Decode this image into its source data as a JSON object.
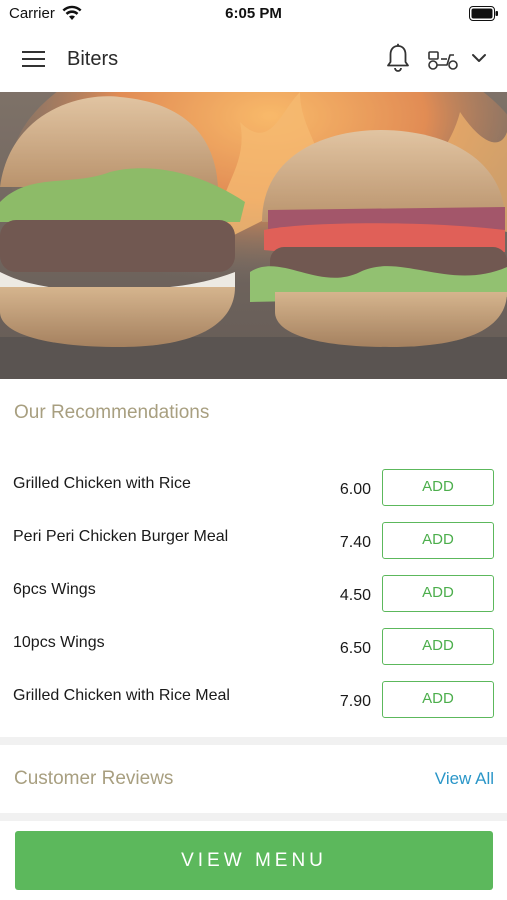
{
  "status_bar": {
    "carrier": "Carrier",
    "time": "6:05 PM"
  },
  "nav": {
    "title": "Biters",
    "icons": [
      "menu-icon",
      "bell-icon",
      "scooter-icon",
      "chevron-down-icon"
    ]
  },
  "hero": {
    "description_icon": "burgers-hero-image"
  },
  "recommendations": {
    "title": "Our Recommendations",
    "items": [
      {
        "name": "Grilled Chicken with Rice",
        "price": "6.00",
        "action": "ADD"
      },
      {
        "name": "Peri Peri Chicken Burger Meal",
        "price": "7.40",
        "action": "ADD"
      },
      {
        "name": "6pcs Wings",
        "price": "4.50",
        "action": "ADD"
      },
      {
        "name": "10pcs Wings",
        "price": "6.50",
        "action": "ADD"
      },
      {
        "name": "Grilled Chicken with Rice Meal",
        "price": "7.90",
        "action": "ADD"
      }
    ]
  },
  "reviews": {
    "title": "Customer Reviews",
    "view_all": "View All"
  },
  "footer": {
    "view_menu": "VIEW MENU"
  },
  "colors": {
    "accent_green": "#5cb85c",
    "section_title": "#a89f80",
    "link_blue": "#2a96c8"
  }
}
